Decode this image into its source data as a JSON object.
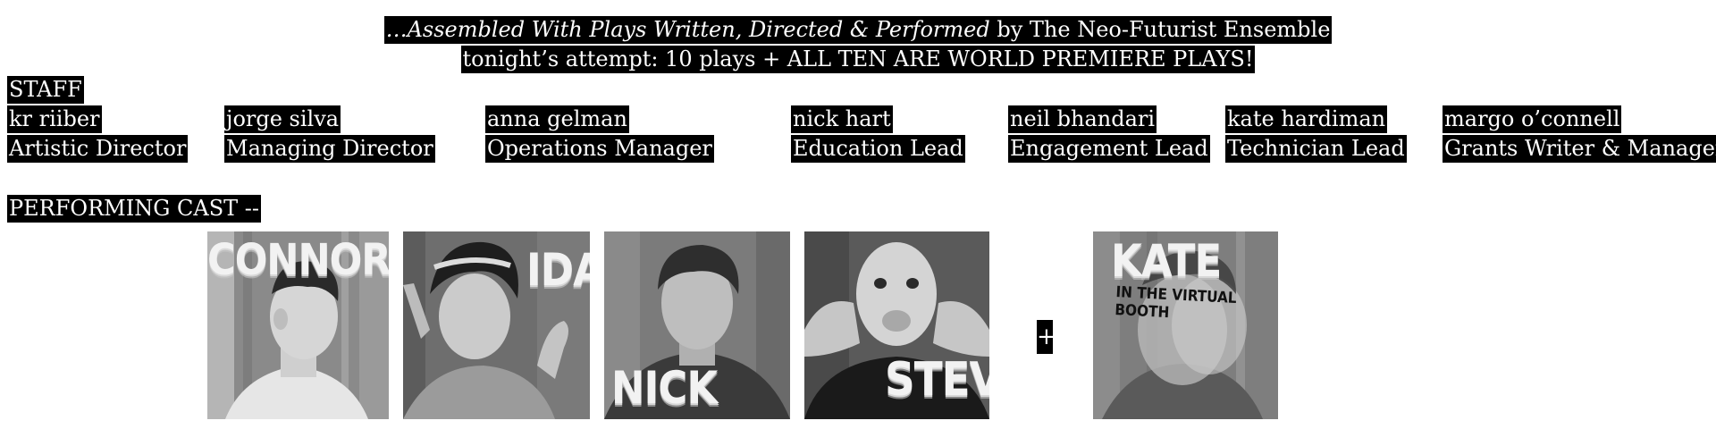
{
  "header": {
    "line1_italic": "…Assembled With Plays Written, Directed & Performed",
    "line1_rest": " by The Neo-Futurist Ensemble",
    "line2": "tonight’s attempt: 10 plays  +  ALL TEN ARE WORLD PREMIERE PLAYS!"
  },
  "staff": {
    "heading": "STAFF",
    "members": [
      {
        "name": "kr  riiber",
        "role": "Artistic Director"
      },
      {
        "name": "jorge silva",
        "role": "Managing Director"
      },
      {
        "name": "anna gelman",
        "role": "Operations Manager"
      },
      {
        "name": "nick hart",
        "role": "Education Lead"
      },
      {
        "name": "neil bhandari",
        "role": "Engagement Lead"
      },
      {
        "name": "kate hardiman",
        "role": "Technician Lead"
      },
      {
        "name": "margo o’connell",
        "role": "Grants Writer & Manager"
      }
    ]
  },
  "cast": {
    "heading": "PERFORMING CAST --",
    "plus": "+",
    "photos": [
      {
        "name": "CONNOR",
        "icon": "connor-photo"
      },
      {
        "name": "IDA",
        "icon": "ida-photo"
      },
      {
        "name": "NICK",
        "icon": "nick-photo"
      },
      {
        "name": "STEVE",
        "icon": "steve-photo"
      },
      {
        "name": "KATE",
        "caption": "IN THE VIRTUAL BOOTH",
        "icon": "kate-photo"
      }
    ]
  }
}
